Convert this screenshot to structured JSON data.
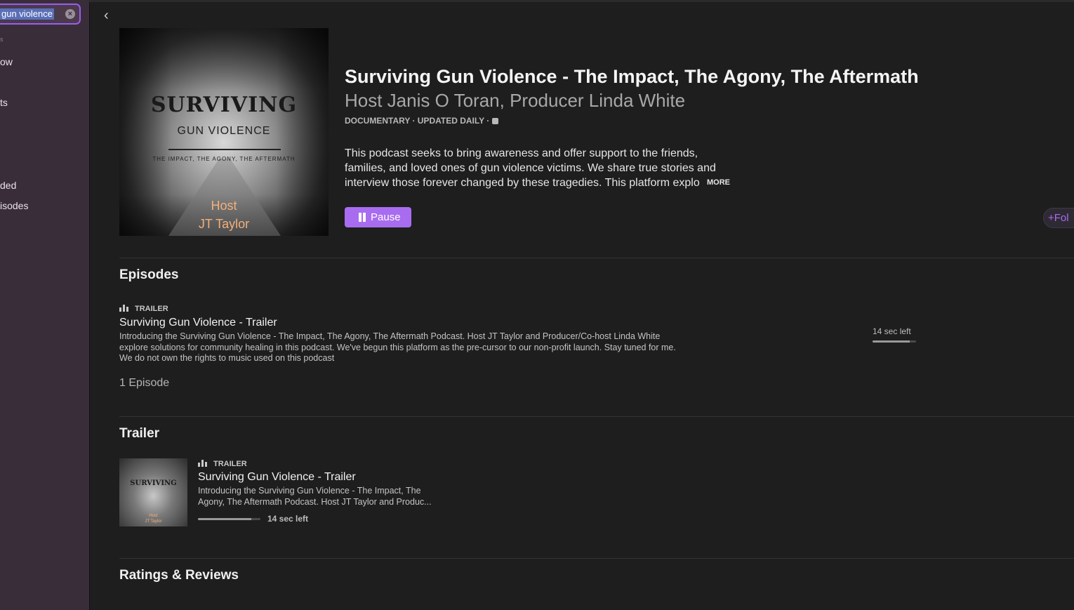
{
  "sidebar": {
    "search_value": "gun violence",
    "items": [
      "ow",
      "ts",
      "ded",
      "isodes"
    ]
  },
  "podcast": {
    "title": "Surviving Gun Violence - The Impact, The Agony, The Aftermath",
    "author": "Host Janis O Toran, Producer Linda White",
    "meta": "DOCUMENTARY · UPDATED DAILY ·",
    "description": "This podcast seeks to bring awareness and offer support to the friends, families, and loved ones of gun violence victims. We share true stories and interview those forever changed by these tragedies.  This platform explo",
    "more_label": "MORE",
    "pause_label": "Pause",
    "follow_label": "Fol",
    "artwork": {
      "line1": "SURVIVING",
      "line2": "GUN VIOLENCE",
      "line3": "THE IMPACT, THE AGONY, THE AFTERMATH",
      "host1": "Host",
      "host2": "JT Taylor"
    }
  },
  "episodes_section": {
    "heading": "Episodes",
    "episode": {
      "badge": "TRAILER",
      "title": "Surviving Gun Violence - Trailer",
      "desc1": "Introducing the Surviving Gun Violence - The Impact, The Agony, The Aftermath Podcast.  Host JT Taylor and Producer/Co-host Linda White",
      "desc2": "explore solutions for community healing in this podcast.  We've begun this platform as the pre-cursor to our non-profit launch.  Stay tuned for me.",
      "desc3": "We do not own the rights to music used on this podcast",
      "time_left": "14 sec left",
      "progress_pct": 85
    },
    "count": "1 Episode"
  },
  "trailer_section": {
    "heading": "Trailer",
    "thumb_line1": "SURVIVING",
    "thumb_host1": "Host",
    "thumb_host2": "JT Taylor",
    "badge": "TRAILER",
    "title": "Surviving Gun Violence - Trailer",
    "desc1": "Introducing the Surviving Gun Violence - The Impact, The",
    "desc2": "Agony, The Aftermath Podcast.  Host JT Taylor and Produc...",
    "time_left": "14 sec left",
    "progress_pct": 85
  },
  "ratings_section": {
    "heading": "Ratings & Reviews"
  },
  "colors": {
    "accent": "#a86cf0",
    "background": "#1e1e1e",
    "sidebar": "#3a2d3a"
  }
}
